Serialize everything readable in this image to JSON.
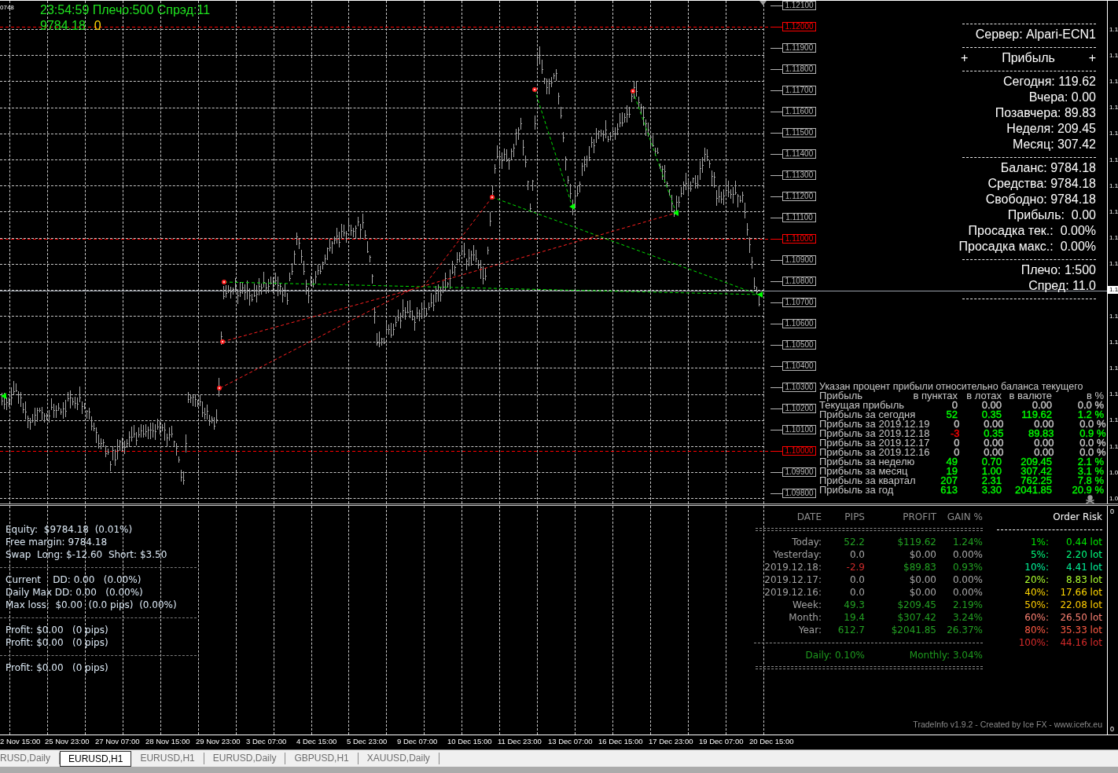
{
  "chart_header": {
    "corner_label": "0748",
    "status_line": "23:54:59 Плечо:500 Спрэд:11",
    "balance": "9784.18",
    "profit": "0"
  },
  "price_levels": [
    {
      "text": "1.12100",
      "kind": "minor"
    },
    {
      "text": "1.12000",
      "kind": "major"
    },
    {
      "text": "1.11900",
      "kind": "minor"
    },
    {
      "text": "1.11800",
      "kind": "minor"
    },
    {
      "text": "1.11700",
      "kind": "minor"
    },
    {
      "text": "1.11600",
      "kind": "minor"
    },
    {
      "text": "1.11500",
      "kind": "minor"
    },
    {
      "text": "1.11400",
      "kind": "minor"
    },
    {
      "text": "1.11300",
      "kind": "minor"
    },
    {
      "text": "1.11200",
      "kind": "minor"
    },
    {
      "text": "1.11100",
      "kind": "minor"
    },
    {
      "text": "1.11000",
      "kind": "major"
    },
    {
      "text": "1.10900",
      "kind": "minor"
    },
    {
      "text": "1.10800",
      "kind": "minor"
    },
    {
      "text": "1.10700",
      "kind": "minor"
    },
    {
      "text": "1.10600",
      "kind": "minor"
    },
    {
      "text": "1.10500",
      "kind": "minor"
    },
    {
      "text": "1.10400",
      "kind": "minor"
    },
    {
      "text": "1.10300",
      "kind": "minor"
    },
    {
      "text": "1.10200",
      "kind": "minor"
    },
    {
      "text": "1.10100",
      "kind": "minor"
    },
    {
      "text": "1.10000",
      "kind": "major"
    },
    {
      "text": "1.09900",
      "kind": "minor"
    },
    {
      "text": "1.09800",
      "kind": "minor"
    }
  ],
  "info_panel": {
    "server": "Сервер: Alpari-ECN1",
    "profit_header": {
      "left_mark": "+",
      "title": "Прибыль",
      "right_mark": "+"
    },
    "profit_rows": [
      "Сегодня: 119.62",
      "Вчера: 0.00",
      "Позавчера: 89.83",
      "Неделя: 209.45",
      "Месяц: 307.42"
    ],
    "account_rows": [
      "Баланс: 9784.18",
      "Средства: 9784.18",
      "Свободно: 9784.18",
      "Прибыль:  0.00",
      "Просадка тек.:  0.00%",
      "Просадка макс.:  0.00%"
    ],
    "terms_rows": [
      "Плечо: 1:500",
      "Спред: 11.0"
    ]
  },
  "profit_table": {
    "title": "Указан процент прибыли относительно баланса текущего",
    "label_column": "Прибыль",
    "columns": [
      "в пунктах",
      "в лотах",
      "в валюте",
      "в %"
    ],
    "rows": [
      {
        "label": "Текущая прибыль",
        "cells": [
          {
            "text": "0",
            "color": "#c8c8c8"
          },
          {
            "text": "0.00",
            "color": "#c8c8c8"
          },
          {
            "text": "0.00",
            "color": "#c8c8c8"
          },
          {
            "text": "0.0 %",
            "color": "#c8c8c8"
          }
        ]
      },
      {
        "label": "Прибыль за сегодня",
        "cells": [
          {
            "text": "52",
            "color": "#00ff00"
          },
          {
            "text": "0.35",
            "color": "#00ff00"
          },
          {
            "text": "119.62",
            "color": "#00ff00"
          },
          {
            "text": "1.2 %",
            "color": "#00ff00"
          }
        ]
      },
      {
        "label": "Прибыль за 2019.12.19",
        "cells": [
          {
            "text": "0",
            "color": "#c8c8c8"
          },
          {
            "text": "0.00",
            "color": "#c8c8c8"
          },
          {
            "text": "0.00",
            "color": "#c8c8c8"
          },
          {
            "text": "0.0 %",
            "color": "#c8c8c8"
          }
        ]
      },
      {
        "label": "Прибыль за 2019.12.18",
        "cells": [
          {
            "text": "-3",
            "color": "#ff0000"
          },
          {
            "text": "0.35",
            "color": "#00ff00"
          },
          {
            "text": "89.83",
            "color": "#00ff00"
          },
          {
            "text": "0.9 %",
            "color": "#00ff00"
          }
        ]
      },
      {
        "label": "Прибыль за 2019.12.17",
        "cells": [
          {
            "text": "0",
            "color": "#c8c8c8"
          },
          {
            "text": "0.00",
            "color": "#c8c8c8"
          },
          {
            "text": "0.00",
            "color": "#c8c8c8"
          },
          {
            "text": "0.0 %",
            "color": "#c8c8c8"
          }
        ]
      },
      {
        "label": "Прибыль за 2019.12.16",
        "cells": [
          {
            "text": "0",
            "color": "#c8c8c8"
          },
          {
            "text": "0.00",
            "color": "#c8c8c8"
          },
          {
            "text": "0.00",
            "color": "#c8c8c8"
          },
          {
            "text": "0.0 %",
            "color": "#c8c8c8"
          }
        ]
      },
      {
        "label": "Прибыль за неделю",
        "cells": [
          {
            "text": "49",
            "color": "#00ff00"
          },
          {
            "text": "0.70",
            "color": "#00ff00"
          },
          {
            "text": "209.45",
            "color": "#00ff00"
          },
          {
            "text": "2.1 %",
            "color": "#00ff00"
          }
        ]
      },
      {
        "label": "Прибыль за месяц",
        "cells": [
          {
            "text": "19",
            "color": "#00ff00"
          },
          {
            "text": "1.00",
            "color": "#00ff00"
          },
          {
            "text": "307.42",
            "color": "#00ff00"
          },
          {
            "text": "3.1 %",
            "color": "#00ff00"
          }
        ]
      },
      {
        "label": "Прибыль за квартал",
        "cells": [
          {
            "text": "207",
            "color": "#00ff00"
          },
          {
            "text": "2.31",
            "color": "#00ff00"
          },
          {
            "text": "762.25",
            "color": "#00ff00"
          },
          {
            "text": "7.8 %",
            "color": "#00ff00"
          }
        ]
      },
      {
        "label": "Прибыль за год",
        "cells": [
          {
            "text": "613",
            "color": "#00ff00"
          },
          {
            "text": "3.30",
            "color": "#00ff00"
          },
          {
            "text": "2041.85",
            "color": "#00ff00"
          },
          {
            "text": "20.9 %",
            "color": "#00ff00"
          }
        ]
      }
    ]
  },
  "price_axis": {
    "labels": [
      {
        "text": "1.1",
        "current": false
      },
      {
        "text": "1.1",
        "current": false
      },
      {
        "text": "1.1",
        "current": false
      },
      {
        "text": "1.1",
        "current": false
      },
      {
        "text": "1.1",
        "current": false
      },
      {
        "text": "1.1",
        "current": false
      },
      {
        "text": "1.1",
        "current": false
      },
      {
        "text": "1.1",
        "current": false
      },
      {
        "text": "1.1",
        "current": false
      },
      {
        "text": "1.1",
        "current": false
      },
      {
        "text": "1.1",
        "current": true
      },
      {
        "text": "1.1",
        "current": false
      },
      {
        "text": "1.1",
        "current": false
      },
      {
        "text": "1.1",
        "current": false
      },
      {
        "text": "1.1",
        "current": false
      },
      {
        "text": "1.1",
        "current": false
      },
      {
        "text": "1.1",
        "current": false
      },
      {
        "text": "1.0",
        "current": false
      },
      {
        "text": "1.0",
        "current": false
      }
    ]
  },
  "account_summary": {
    "groups": [
      [
        "Equity:  $9784.18  (0.01%)",
        "Free margin: 9784.18",
        "Swap  Long: $-12.60  Short: $3.50"
      ],
      [
        "Current    DD: 0.00   (0.00%)",
        "Daily Max DD: 0.00   (0.00%)",
        "Max loss:  $0.00  (0.0 pips)  (0.00%)"
      ],
      [
        "Profit: $0.00   (0 pips)",
        "Profit: $0.00   (0 pips)"
      ],
      [
        "Profit: $0.00   (0 pips)"
      ]
    ]
  },
  "trade_info": {
    "label_column": "DATE",
    "columns": [
      "PIPS",
      "PROFIT",
      "GAIN %"
    ],
    "rows": [
      {
        "label": "Today:",
        "cells": [
          {
            "text": "52.2",
            "color": "#22a022"
          },
          {
            "text": "$119.62",
            "color": "#22a022"
          },
          {
            "text": "1.24%",
            "color": "#22a022"
          }
        ]
      },
      {
        "label": "Yesterday:",
        "cells": [
          {
            "text": "0.0",
            "color": "#a8a8a8"
          },
          {
            "text": "$0.00",
            "color": "#a8a8a8"
          },
          {
            "text": "0.00%",
            "color": "#a8a8a8"
          }
        ]
      },
      {
        "label": "2019.12.18:",
        "cells": [
          {
            "text": "-2.9",
            "color": "#cc2a2a"
          },
          {
            "text": "$89.83",
            "color": "#22a022"
          },
          {
            "text": "0.93%",
            "color": "#22a022"
          }
        ]
      },
      {
        "label": "2019.12.17:",
        "cells": [
          {
            "text": "0.0",
            "color": "#a8a8a8"
          },
          {
            "text": "$0.00",
            "color": "#a8a8a8"
          },
          {
            "text": "0.00%",
            "color": "#a8a8a8"
          }
        ]
      },
      {
        "label": "2019.12.16:",
        "cells": [
          {
            "text": "0.0",
            "color": "#a8a8a8"
          },
          {
            "text": "$0.00",
            "color": "#a8a8a8"
          },
          {
            "text": "0.00%",
            "color": "#a8a8a8"
          }
        ]
      },
      {
        "label": "Week:",
        "cells": [
          {
            "text": "49.3",
            "color": "#22a022"
          },
          {
            "text": "$209.45",
            "color": "#22a022"
          },
          {
            "text": "2.19%",
            "color": "#22a022"
          }
        ]
      },
      {
        "label": "Month:",
        "cells": [
          {
            "text": "19.4",
            "color": "#22a022"
          },
          {
            "text": "$307.42",
            "color": "#22a022"
          },
          {
            "text": "3.24%",
            "color": "#22a022"
          }
        ]
      },
      {
        "label": "Year:",
        "cells": [
          {
            "text": "612.7",
            "color": "#22a022"
          },
          {
            "text": "$2041.85",
            "color": "#22a022"
          },
          {
            "text": "26.37%",
            "color": "#22a022"
          }
        ]
      }
    ],
    "daily": "Daily: 0.10%",
    "monthly": "Monthly: 3.04%",
    "footer": "TradeInfo v1.9.2 - Created by Ice FX - www.icefx.eu"
  },
  "order_risk": {
    "title": "Order Risk",
    "rows": [
      {
        "percent": "1%:",
        "lots": "0.44 lot",
        "color": "#00e600"
      },
      {
        "percent": "5%:",
        "lots": "2.20 lot",
        "color": "#00ff7f"
      },
      {
        "percent": "10%:",
        "lots": "4.41 lot",
        "color": "#00f59a"
      },
      {
        "percent": "20%:",
        "lots": "8.83 lot",
        "color": "#adff2f"
      },
      {
        "percent": "40%:",
        "lots": "17.66 lot",
        "color": "#ffd700"
      },
      {
        "percent": "50%:",
        "lots": "22.08 lot",
        "color": "#ffcc00"
      },
      {
        "percent": "60%:",
        "lots": "26.50 lot",
        "color": "#fa8072"
      },
      {
        "percent": "80%:",
        "lots": "35.33 lot",
        "color": "#ff5a44"
      },
      {
        "percent": "100%:",
        "lots": "44.16 lot",
        "color": "#d62a2a"
      }
    ]
  },
  "indicator_axis": {
    "labels": [
      "0",
      "0"
    ]
  },
  "time_axis": {
    "labels": [
      "2 Nov 15:00",
      "25 Nov 23:00",
      "27 Nov 07:00",
      "28 Nov 15:00",
      "29 Nov 23:00",
      "3 Dec 07:00",
      "4 Dec 15:00",
      "5 Dec 23:00",
      "9 Dec 07:00",
      "10 Dec 15:00",
      "11 Dec 23:00",
      "13 Dec 07:00",
      "16 Dec 15:00",
      "17 Dec 23:00",
      "19 Dec 07:00",
      "20 Dec 15:00"
    ]
  },
  "tabs": [
    {
      "label": "RUSD,Daily",
      "selected": false
    },
    {
      "label": "EURUSD,H1",
      "selected": true
    },
    {
      "label": "EURUSD,H1",
      "selected": false
    },
    {
      "label": "EURUSD,Daily",
      "selected": false
    },
    {
      "label": "GBPUSD,H1",
      "selected": false
    },
    {
      "label": "XAUUSD,Daily",
      "selected": false
    }
  ]
}
